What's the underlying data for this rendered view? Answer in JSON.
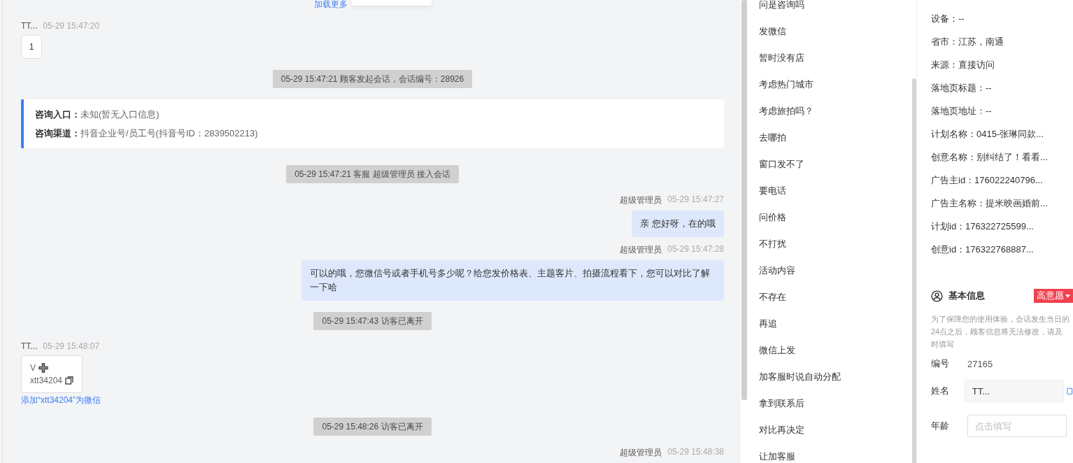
{
  "chat": {
    "load_more": "加载更多",
    "messages": [
      {
        "kind": "customer",
        "name": "TT...",
        "time": "05-29 15:47:20",
        "text": "1"
      },
      {
        "kind": "system",
        "text": "05-29 15:47:21 顾客发起会话，会话编号：28926"
      },
      {
        "kind": "info",
        "lines": [
          {
            "label": "咨询入口：",
            "value": "未知(暂无入口信息)"
          },
          {
            "label": "咨询渠道：",
            "value": "抖音企业号/员工号(抖音号ID：2839502213)"
          }
        ]
      },
      {
        "kind": "system",
        "text": "05-29 15:47:21 客服 超级管理员 接入会话"
      },
      {
        "kind": "agent",
        "name": "超级管理员",
        "time": "05-29 15:47:27",
        "text": "亲 您好呀，在的哦"
      },
      {
        "kind": "agent",
        "name": "超级管理员",
        "time": "05-29 15:47:28",
        "text": "可以的哦，您微信号或者手机号多少呢？给您发价格表、主题客片、拍摄流程看下，您可以对比了解一下哈"
      },
      {
        "kind": "system",
        "text": "05-29 15:47:43 访客已离开"
      },
      {
        "kind": "wechat",
        "name": "TT...",
        "time": "05-29 15:48:07",
        "prefix": "V",
        "wechat_id": "xtt34204",
        "link": "添加“xtt34204”为微信"
      },
      {
        "kind": "system",
        "text": "05-29 15:48:26 访客已离开"
      },
      {
        "kind": "agent",
        "name": "超级管理员",
        "time": "05-29 15:48:38"
      }
    ]
  },
  "quick_replies": [
    "问是咨询吗",
    "发微信",
    "暂时没有店",
    "考虑热门城市",
    "考虑旅拍吗？",
    "去哪拍",
    "窗口发不了",
    "要电话",
    "问价格",
    "不打扰",
    "活动内容",
    "不存在",
    "再追",
    "微信上发",
    "加客服时说自动分配",
    "拿到联系后",
    "对比再决定",
    "让加客服"
  ],
  "visitor_details": [
    "设备：--",
    "省市：江苏，南通",
    "来源：直接访问",
    "落地页标题：--",
    "落地页地址：--",
    "计划名称：0415-张琳同款...",
    "创意名称：别纠结了！看看...",
    "广告主id：176022240796...",
    "广告主名称：提米映画婚前...",
    "计划id：176322725599...",
    "创意id：176322768887..."
  ],
  "basic_info": {
    "title": "基本信息",
    "intent_tag": "高意愿",
    "note": "为了保障您的使用体验，会话发生当日的24点之后，顾客信息将无法修改，请及时填写",
    "number_label": "编号",
    "number": "27165",
    "name_label": "姓名",
    "name_value": "TT...",
    "age_label": "年龄",
    "age_placeholder": "点击填写"
  }
}
